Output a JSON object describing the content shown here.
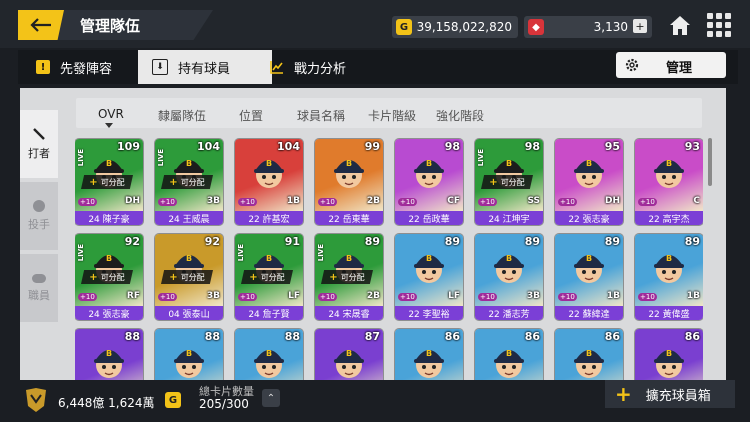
{
  "header": {
    "title": "管理隊伍",
    "gold_icon": "G",
    "gold_value": "39,158,022,820",
    "gem_value": "3,130"
  },
  "tabs": [
    {
      "label": "先發陣容",
      "icon": "exclamation-icon"
    },
    {
      "label": "持有球員",
      "icon": "download-icon"
    },
    {
      "label": "戰力分析",
      "icon": "chart-icon"
    }
  ],
  "manage_label": "管理",
  "side_tabs": [
    {
      "label": "打者",
      "icon": "bat-icon"
    },
    {
      "label": "投手",
      "icon": "ball-icon"
    },
    {
      "label": "職員",
      "icon": "staff-icon"
    }
  ],
  "sort_options": [
    "OVR",
    "隸屬隊伍",
    "位置",
    "球員名稱",
    "卡片階級",
    "強化階段"
  ],
  "cards": [
    {
      "name": "24 陳子豪",
      "ovr": "109",
      "pos": "DH",
      "live": "LIVE",
      "alloc": "可分配",
      "level": "+10",
      "bg": "#2d9b3a",
      "team": "bros"
    },
    {
      "name": "24 王威晨",
      "ovr": "104",
      "pos": "3B",
      "live": "LIVE",
      "alloc": "可分配",
      "level": "+10",
      "bg": "#2d9b3a",
      "team": "bros"
    },
    {
      "name": "22 許基宏",
      "ovr": "104",
      "pos": "1B",
      "live": "",
      "alloc": "",
      "level": "+10",
      "bg": "#d8403b",
      "team": "player"
    },
    {
      "name": "22 岳東華",
      "ovr": "99",
      "pos": "2B",
      "live": "",
      "alloc": "",
      "level": "+10",
      "bg": "#e07b2c",
      "team": "player"
    },
    {
      "name": "22 岳政華",
      "ovr": "98",
      "pos": "CF",
      "live": "",
      "alloc": "",
      "level": "+10",
      "bg": "#b84bd1",
      "team": "player"
    },
    {
      "name": "24 江坤宇",
      "ovr": "98",
      "pos": "SS",
      "live": "LIVE",
      "alloc": "可分配",
      "level": "+10",
      "bg": "#2d9b3a",
      "team": "bros"
    },
    {
      "name": "22 張志豪",
      "ovr": "95",
      "pos": "DH",
      "live": "",
      "alloc": "",
      "level": "+10",
      "bg": "#c94cc8",
      "team": "player"
    },
    {
      "name": "22 高宇杰",
      "ovr": "93",
      "pos": "C",
      "live": "",
      "alloc": "",
      "level": "+10",
      "bg": "#c94cc8",
      "team": "player"
    },
    {
      "name": "24 張志豪",
      "ovr": "92",
      "pos": "RF",
      "live": "LIVE",
      "alloc": "可分配",
      "level": "+10",
      "bg": "#2d9b3a",
      "team": "bros"
    },
    {
      "name": "04 張泰山",
      "ovr": "92",
      "pos": "3B",
      "live": "",
      "alloc": "可分配",
      "level": "+10",
      "bg": "#c99a2a",
      "team": "player"
    },
    {
      "name": "24 詹子賢",
      "ovr": "91",
      "pos": "LF",
      "live": "LIVE",
      "alloc": "可分配",
      "level": "+10",
      "bg": "#2d9b3a",
      "team": "player"
    },
    {
      "name": "24 宋晟睿",
      "ovr": "89",
      "pos": "2B",
      "live": "LIVE",
      "alloc": "可分配",
      "level": "+10",
      "bg": "#2d9b3a",
      "team": "player"
    },
    {
      "name": "22 李聖裕",
      "ovr": "89",
      "pos": "LF",
      "live": "",
      "alloc": "",
      "level": "+10",
      "bg": "#4aa3d8",
      "team": "player"
    },
    {
      "name": "22 潘志芳",
      "ovr": "89",
      "pos": "3B",
      "live": "",
      "alloc": "",
      "level": "+10",
      "bg": "#4aa3d8",
      "team": "player"
    },
    {
      "name": "22 蘇緯達",
      "ovr": "89",
      "pos": "1B",
      "live": "",
      "alloc": "",
      "level": "+10",
      "bg": "#4aa3d8",
      "team": "player"
    },
    {
      "name": "22 黃偉盛",
      "ovr": "89",
      "pos": "1B",
      "live": "",
      "alloc": "",
      "level": "+10",
      "bg": "#4aa3d8",
      "team": "player"
    },
    {
      "name": "",
      "ovr": "88",
      "pos": "",
      "live": "",
      "alloc": "",
      "level": "",
      "bg": "#7a3fd0",
      "team": "player"
    },
    {
      "name": "",
      "ovr": "88",
      "pos": "",
      "live": "",
      "alloc": "",
      "level": "",
      "bg": "#4aa3d8",
      "team": "player"
    },
    {
      "name": "",
      "ovr": "88",
      "pos": "",
      "live": "",
      "alloc": "",
      "level": "",
      "bg": "#4aa3d8",
      "team": "player"
    },
    {
      "name": "",
      "ovr": "87",
      "pos": "",
      "live": "",
      "alloc": "",
      "level": "",
      "bg": "#7a3fd0",
      "team": "player"
    },
    {
      "name": "",
      "ovr": "86",
      "pos": "",
      "live": "",
      "alloc": "",
      "level": "",
      "bg": "#4aa3d8",
      "team": "player"
    },
    {
      "name": "",
      "ovr": "86",
      "pos": "",
      "live": "",
      "alloc": "",
      "level": "",
      "bg": "#4aa3d8",
      "team": "player"
    },
    {
      "name": "",
      "ovr": "86",
      "pos": "",
      "live": "",
      "alloc": "",
      "level": "",
      "bg": "#4aa3d8",
      "team": "player"
    },
    {
      "name": "",
      "ovr": "86",
      "pos": "",
      "live": "",
      "alloc": "",
      "level": "",
      "bg": "#7a3fd0",
      "team": "player"
    }
  ],
  "footer": {
    "money": "6,448億 1,624萬",
    "money_badge": "G",
    "capacity_label": "總卡片數量",
    "capacity_value": "205/300",
    "expand_label": "擴充球員箱"
  }
}
